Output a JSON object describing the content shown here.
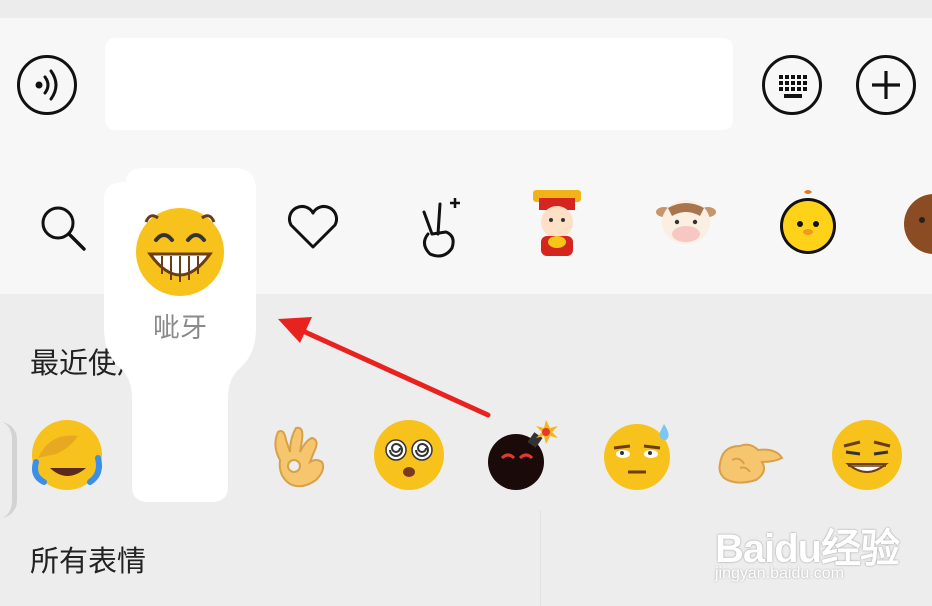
{
  "tabs": [
    {
      "name": "search",
      "icon": "search-icon"
    },
    {
      "name": "favorites",
      "icon": "heart-icon"
    },
    {
      "name": "gesture-sticker",
      "icon": "victory-hand-icon"
    },
    {
      "name": "caishen-sticker",
      "icon": "god-of-wealth-icon"
    },
    {
      "name": "cow-sticker",
      "icon": "cow-face-icon"
    },
    {
      "name": "chick-sticker",
      "icon": "yellow-chick-icon"
    },
    {
      "name": "bear-sticker",
      "icon": "brown-bear-icon"
    }
  ],
  "input_bar": {
    "left_icon": "voice-icon",
    "right_icons": [
      "keyboard-icon",
      "plus-icon"
    ],
    "value": ""
  },
  "preview": {
    "label": "呲牙",
    "emoji": "grin-emoji"
  },
  "sections": {
    "recent_title": "最近使用",
    "all_title": "所有表情"
  },
  "recent_emojis": [
    "facepalm-laugh-emoji",
    "grin-emoji",
    "ok-hand-emoji",
    "dizzy-eyes-emoji",
    "bomb-emoji",
    "sweat-eye-roll-emoji",
    "fist-bump-emoji",
    "smirk-grin-emoji"
  ],
  "watermark": {
    "logo": "Baidu经验",
    "url": "jingyan.baidu.com"
  },
  "annotation": {
    "arrow_color": "#e8231f"
  },
  "colors": {
    "background": "#ededed",
    "bar": "#f7f7f7",
    "input": "#ffffff"
  }
}
